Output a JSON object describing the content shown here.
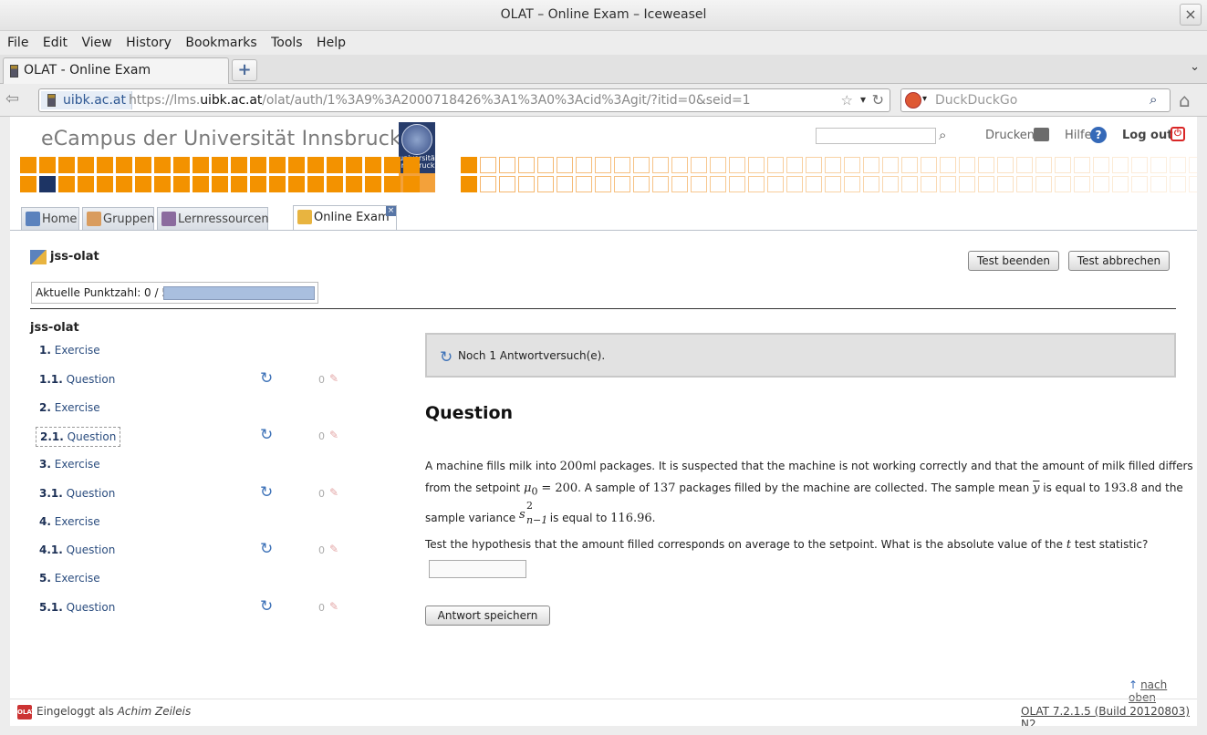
{
  "window": {
    "title": "OLAT – Online Exam – Iceweasel"
  },
  "menu": [
    "File",
    "Edit",
    "View",
    "History",
    "Bookmarks",
    "Tools",
    "Help"
  ],
  "browser_tab": {
    "label": "OLAT - Online Exam"
  },
  "urlbar": {
    "identity": "uibk.ac.at",
    "url_prefix": "https://lms.",
    "url_host": "uibk.ac.at",
    "url_rest": "/olat/auth/1%3A9%3A2000718426%3A1%3A0%3Acid%3Agit/?itid=0&seid=1"
  },
  "searchbar": {
    "placeholder": "DuckDuckGo"
  },
  "header": {
    "brand": "eCampus der Universität Innsbruck",
    "seal_label": "universität innsbruck",
    "print_label": "Drucken",
    "help_label": "Hilfe",
    "logout_label": "Log out"
  },
  "nav_tabs": [
    "Home",
    "Gruppen",
    "Lernressourcen"
  ],
  "active_tab": "Online Exam",
  "exam": {
    "title": "jss-olat",
    "score_label": "Aktuelle Punktzahl: 0 / 5",
    "score_fraction": 0,
    "end_button": "Test beenden",
    "cancel_button": "Test abbrechen"
  },
  "toc": {
    "title": "jss-olat",
    "items": [
      {
        "num": "1.",
        "label": "Exercise"
      },
      {
        "num": "1.1.",
        "label": "Question",
        "points": "0"
      },
      {
        "num": "2.",
        "label": "Exercise"
      },
      {
        "num": "2.1.",
        "label": "Question",
        "points": "0"
      },
      {
        "num": "3.",
        "label": "Exercise"
      },
      {
        "num": "3.1.",
        "label": "Question",
        "points": "0"
      },
      {
        "num": "4.",
        "label": "Exercise"
      },
      {
        "num": "4.1.",
        "label": "Question",
        "points": "0"
      },
      {
        "num": "5.",
        "label": "Exercise"
      },
      {
        "num": "5.1.",
        "label": "Question",
        "points": "0"
      }
    ]
  },
  "question": {
    "attempts_notice": "Noch 1 Antwortversuch(e).",
    "heading": "Question",
    "line1_a": "A machine fills milk into",
    "line1_m": "200",
    "line1_b": "ml packages. It is suspected that the machine is not working correctly and that the amount of milk filled differs",
    "line2_a": "from the setpoint",
    "mu": "μ",
    "mu_sub": "0",
    "mu_eq": "= 200",
    "line2_b": ". A sample of",
    "n": "137",
    "line2_c": "packages filled by the machine are collected. The sample mean",
    "ybar": "y",
    "line2_d": "is equal to",
    "mean": "193.8",
    "line2_e": "and the",
    "line3_a": "sample variance",
    "s": "s",
    "s_sup": "2",
    "s_sub": "n−1",
    "line3_b": "is equal to",
    "var": "116.96",
    "line3_c": ".",
    "line4_a": "Test the hypothesis that the amount filled corresponds on average to the setpoint. What is the absolute value of the",
    "t": "t",
    "line4_b": "test statistic?",
    "answer_value": "",
    "save_button": "Antwort speichern"
  },
  "footer": {
    "to_top": "nach oben",
    "logged_in_prefix": "Eingeloggt als",
    "user": "Achim Zeileis",
    "version": "OLAT 7.2.1.5 (Build 20120803) N2",
    "logo_text": "OLAT"
  },
  "colors": {
    "brand_orange": "#f39200",
    "brand_navy": "#1d3464",
    "link_blue": "#2b4d7f"
  }
}
